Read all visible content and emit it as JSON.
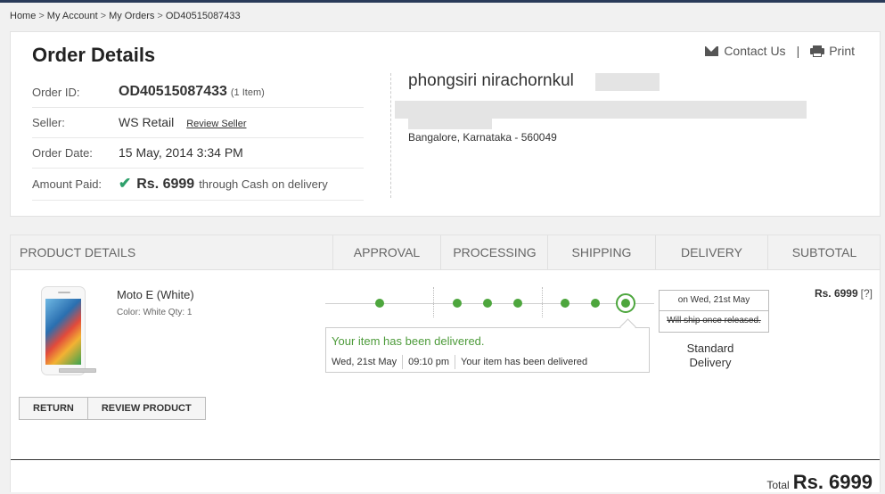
{
  "breadcrumb": [
    "Home",
    "My Account",
    "My Orders",
    "OD40515087433"
  ],
  "breadcrumb_sep": ">",
  "page": {
    "title": "Order Details",
    "contact_label": "Contact Us",
    "divider": "|",
    "print_label": "Print"
  },
  "order": {
    "id_label": "Order ID:",
    "id": "OD40515087433",
    "item_count": "(1 Item)",
    "seller_label": "Seller:",
    "seller": "WS Retail",
    "review_seller": "Review Seller",
    "date_label": "Order Date:",
    "date": "15 May, 2014 3:34 PM",
    "amount_label": "Amount Paid:",
    "amount": "Rs. 6999",
    "payment": "through Cash on delivery"
  },
  "address": {
    "name": "phongsiri nirachornkul",
    "city": "Bangalore, Karnataka - 560049"
  },
  "product_table": {
    "headers": [
      "PRODUCT DETAILS",
      "APPROVAL",
      "PROCESSING",
      "SHIPPING",
      "DELIVERY",
      "SUBTOTAL"
    ]
  },
  "product": {
    "name": "Moto E (White)",
    "meta": "Color: White  Qty: 1",
    "subtotal": "Rs. 6999",
    "help": "[?]",
    "return_btn": "RETURN",
    "review_btn": "REVIEW PRODUCT"
  },
  "tracking": {
    "status": "Your item has been delivered.",
    "date": "Wed, 21st May",
    "time": "09:10 pm",
    "note": "Your item has been delivered"
  },
  "delivery": {
    "on_date": "on Wed, 21st May",
    "ship_note": "Will ship once released.",
    "method": "Standard Delivery"
  },
  "total": {
    "label": "Total",
    "value": "Rs. 6999"
  },
  "colors": {
    "accent_green": "#4da63d",
    "check_green": "#2ea06b",
    "header_bar": "#2a3b59"
  },
  "icons": [
    "envelope-icon",
    "printer-icon",
    "check-icon",
    "help-icon"
  ]
}
